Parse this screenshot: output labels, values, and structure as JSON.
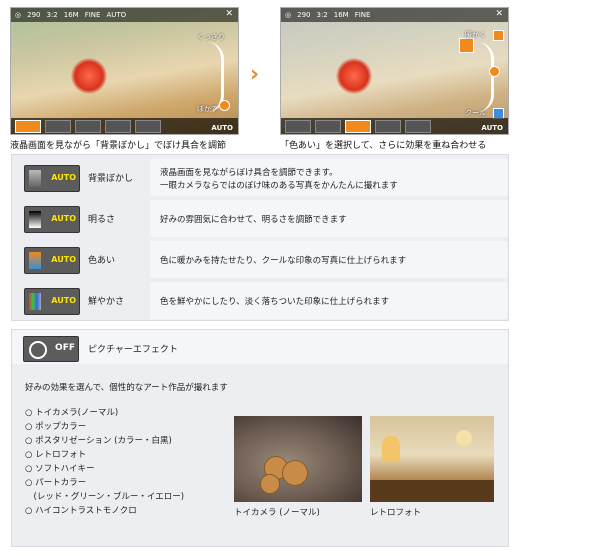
{
  "screen_left": {
    "status": [
      "290",
      "3:2",
      "16M",
      "FINE",
      "AUTO"
    ],
    "slider_top_label": "くっきり",
    "slider_bottom_label": "ぼかす",
    "bottom_auto": "AUTO",
    "caption": "液晶画面を見ながら「背景ぼかし」でぼけ具合を調節"
  },
  "screen_right": {
    "status": [
      "290",
      "3:2",
      "16M",
      "FINE"
    ],
    "slider_top_label": "暖かく",
    "slider_bottom_label": "クール",
    "bottom_auto": "AUTO",
    "caption": "「色あい」を選択して、さらに効果を重ね合わせる"
  },
  "arrow": "›",
  "features": [
    {
      "name": "背景ぼかし",
      "icon": "background-blur-icon",
      "auto": "AUTO",
      "desc": [
        "液晶画面を見ながらぼけ具合を調節できます。",
        "一眼カメラならではのぼけ味のある写真をかんたんに撮れます"
      ]
    },
    {
      "name": "明るさ",
      "icon": "brightness-icon",
      "auto": "AUTO",
      "desc": [
        "好みの雰囲気に合わせて、明るさを調節できます"
      ]
    },
    {
      "name": "色あい",
      "icon": "color-tone-icon",
      "auto": "AUTO",
      "desc": [
        "色に暖かみを持たせたり、クールな印象の写真に仕上げられます"
      ]
    },
    {
      "name": "鮮やかさ",
      "icon": "vividness-icon",
      "auto": "AUTO",
      "desc": [
        "色を鮮やかにしたり、淡く落ちついた印象に仕上げられます"
      ]
    }
  ],
  "picture_effect": {
    "off_label": "OFF",
    "title": "ピクチャーエフェクト",
    "intro": "好みの効果を選んで、個性的なアート作品が撮れます",
    "items": [
      "○ トイカメラ(ノーマル)",
      "○ ポップカラー",
      "○ ポスタリゼーション (カラー・白黒)",
      "○ レトロフォト",
      "○ ソフトハイキー",
      "○ パートカラー",
      "　(レッド・グリーン・ブルー・イエロー)",
      "○ ハイコントラストモノクロ"
    ],
    "photo1_caption": "トイカメラ (ノーマル)",
    "photo2_caption": "レトロフォト"
  },
  "colors": {
    "accent": "#f08a1a",
    "auto_yellow": "#ffe400",
    "cool_blue": "#3a8ee0"
  }
}
